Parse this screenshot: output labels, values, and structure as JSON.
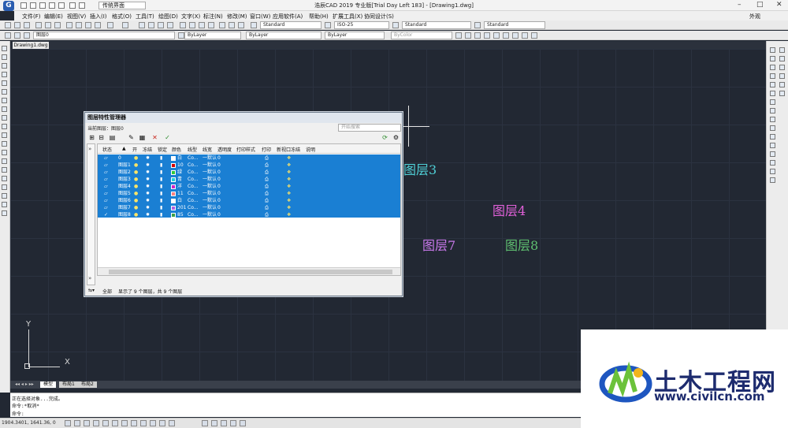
{
  "titlebar": {
    "app_title": "浩辰CAD 2019 专业版[Trial Day Left 183] - [Drawing1.dwg]",
    "workspace": "传统界面",
    "right_label": "外观"
  },
  "menu": [
    "文件(F)",
    "编辑(E)",
    "视图(V)",
    "插入(I)",
    "格式(O)",
    "工具(T)",
    "绘图(D)",
    "文字(X)",
    "标注(N)",
    "修改(M)",
    "窗口(W)",
    "应用软件(A)",
    "帮助(H)",
    "扩展工具(X)",
    "协同设计(S)"
  ],
  "toolbar1": {
    "textstyle": "Standard",
    "dimstyle": "ISO-25",
    "tablestyle": "Standard",
    "mleaderstyle": "Standard"
  },
  "toolbar2": {
    "layer": "图层0",
    "color": "ByLayer",
    "linetype": "ByLayer",
    "lineweight": "ByLayer",
    "plotstyle": "ByColor"
  },
  "document_tab": "Drawing1.dwg",
  "drawing_labels": {
    "layer3": "图层3",
    "layer4": "图层4",
    "layer7": "图层7",
    "layer8": "图层8",
    "color_layer3": "#4fcfd6",
    "color_layer4": "#e060d8",
    "color_layer7": "#c878ea",
    "color_layer8": "#5fbf70"
  },
  "ucs": {
    "x_label": "X",
    "y_label": "Y"
  },
  "layout_tabs": [
    "模型",
    "布局1",
    "布局2"
  ],
  "command_lines": [
    "正在选择对象...完成。",
    "命令:*取消*",
    "命令:"
  ],
  "status": {
    "coords": "1904.3401, 1641.36, 0"
  },
  "layer_dialog": {
    "title": "图层特性管理器",
    "current_layer": "当前图层：图层0",
    "search_placeholder": "开始搜索",
    "columns": [
      "状态",
      "开",
      "冻结",
      "锁定",
      "颜色",
      "线型",
      "线宽",
      "透明度",
      "打印样式",
      "打印",
      "新视口冻结",
      "说明"
    ],
    "rows": [
      {
        "name": "0",
        "color": "白",
        "colorhex": "#ffffff",
        "linetype": "Co...",
        "lineweight": "一默认",
        "transparency": "0"
      },
      {
        "name": "图层1",
        "color": "10",
        "colorhex": "#d40000",
        "linetype": "Co...",
        "lineweight": "一默认",
        "transparency": "0"
      },
      {
        "name": "图层2",
        "color": "绿",
        "colorhex": "#2fc83a",
        "linetype": "Co...",
        "lineweight": "一默认",
        "transparency": "0"
      },
      {
        "name": "图层3",
        "color": "青",
        "colorhex": "#22d0d8",
        "linetype": "Co...",
        "lineweight": "一默认",
        "transparency": "0"
      },
      {
        "name": "图层4",
        "color": "洋",
        "colorhex": "#d020c8",
        "linetype": "Co...",
        "lineweight": "一默认",
        "transparency": "0"
      },
      {
        "name": "图层5",
        "color": "11",
        "colorhex": "#ff8080",
        "linetype": "Co...",
        "lineweight": "一默认",
        "transparency": "0"
      },
      {
        "name": "图层6",
        "color": "白",
        "colorhex": "#ffffff",
        "linetype": "Co...",
        "lineweight": "一默认",
        "transparency": "0"
      },
      {
        "name": "图层7",
        "color": "201",
        "colorhex": "#b060e0",
        "linetype": "Co...",
        "lineweight": "一默认",
        "transparency": "0"
      },
      {
        "name": "图层8",
        "color": "85",
        "colorhex": "#3aa04a",
        "linetype": "Co...",
        "lineweight": "一默认",
        "transparency": "0"
      }
    ],
    "footer_filter": "全部",
    "footer_status": "显示了 9 个图层，共 9 个图层"
  },
  "watermark": {
    "main": "土木工程网",
    "url": "www.civilcn.com"
  }
}
